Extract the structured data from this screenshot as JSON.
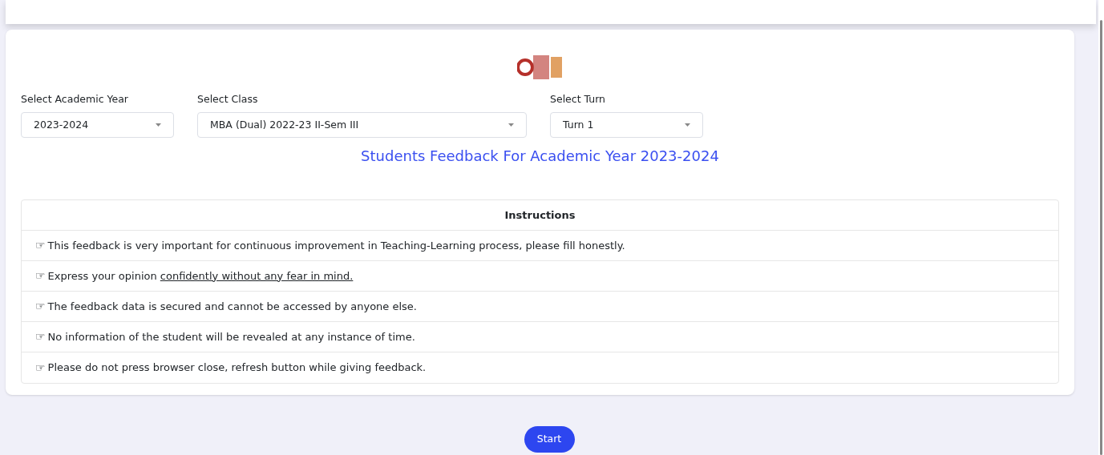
{
  "filters": [
    {
      "label": "Select Academic Year",
      "value": "2023-2024"
    },
    {
      "label": "Select Class",
      "value": "MBA (Dual) 2022-23 II-Sem III"
    },
    {
      "label": "Select Turn",
      "value": "Turn 1"
    }
  ],
  "heading": "Students Feedback For Academic Year 2023-2024",
  "instructions": {
    "title": "Instructions",
    "items": [
      {
        "icon": "☞",
        "text": "This feedback is very important for continuous improvement in Teaching-Learning process, please fill honestly."
      },
      {
        "icon": "☞",
        "text": "Express your opinion ",
        "underlined": "confidently without any fear in mind."
      },
      {
        "icon": "☞",
        "text": "The feedback data is secured and cannot be accessed by anyone else."
      },
      {
        "icon": "☞",
        "text": "No information of the student will be revealed at any instance of time."
      },
      {
        "icon": "☞",
        "text": "Please do not press browser close, refresh button while giving feedback."
      }
    ]
  },
  "start_button": "Start"
}
